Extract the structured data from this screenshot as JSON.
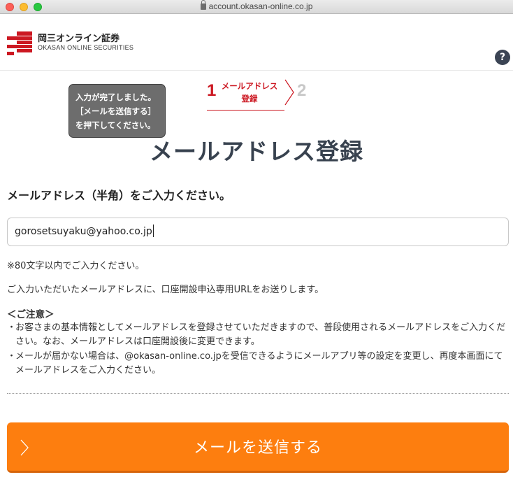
{
  "browser": {
    "url": "account.okasan-online.co.jp"
  },
  "header": {
    "logo_jp": "岡三オンライン証券",
    "logo_en": "OKASAN ONLINE SECURITIES",
    "help_label": "?"
  },
  "tooltip": {
    "lines": [
      "入力が完了しました。",
      "［メールを送信する］",
      "を押下してください。"
    ]
  },
  "steps": [
    {
      "number": "1",
      "label_line1": "メールアドレス",
      "label_line2": "登録",
      "active": true
    },
    {
      "number": "2",
      "active": false
    }
  ],
  "page_title": "メールアドレス登録",
  "form": {
    "label": "メールアドレス（半角）をご入力ください。",
    "email_value": "gorosetsuyaku@yahoo.co.jp",
    "note_length": "※80文字以内でご入力ください。",
    "note_url": "ご入力いただいたメールアドレスに、口座開設申込専用URLをお送りします。"
  },
  "caution": {
    "heading": "＜ご注意＞",
    "bullet": "・",
    "items": [
      "お客さまの基本情報としてメールアドレスを登録させていただきますので、普段使用されるメールアドレスをご入力ください。なお、メールアドレスは口座開設後に変更できます。",
      "メールが届かない場合は、@okasan-online.co.jpを受信できるようにメールアプリ等の設定を変更し、再度本画面にてメールアドレスをご入力ください。"
    ]
  },
  "send_button": {
    "label": "メールを送信する"
  },
  "colors": {
    "brand_red": "#cc1822",
    "button_orange": "#fd7e0f",
    "title_navy": "#38424f",
    "tooltip_gray": "#6d6d6d"
  }
}
